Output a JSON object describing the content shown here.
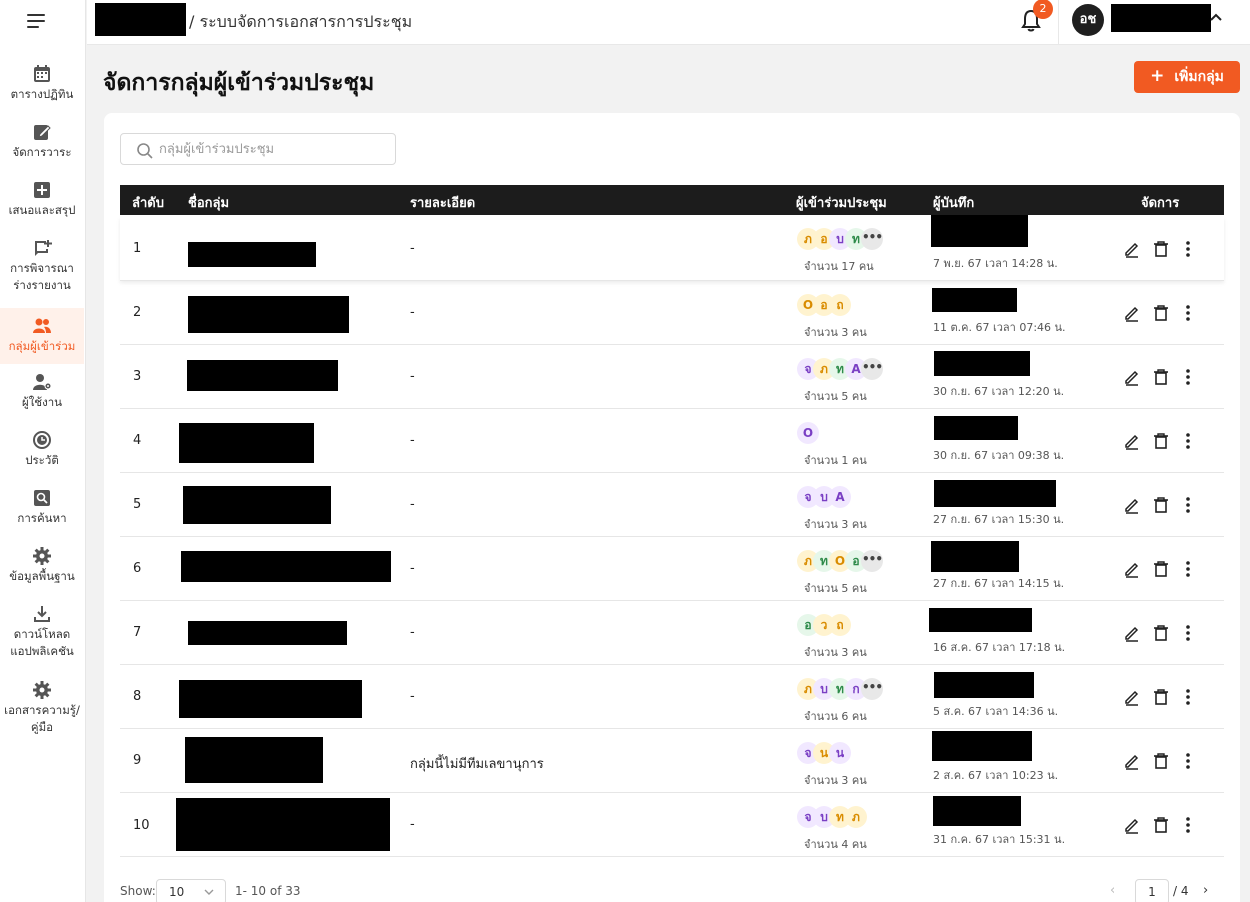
{
  "sidebar": {
    "items": [
      {
        "label": "ตารางปฏิทิน",
        "icon": "calendar-icon"
      },
      {
        "label": "จัดการวาระ",
        "icon": "edit-agenda-icon"
      },
      {
        "label": "เสนอและสรุป",
        "icon": "add-box-icon"
      },
      {
        "label": "การพิจารณาร่างรายงาน",
        "icon": "comment-add-icon"
      },
      {
        "label": "กลุ่มผู้เข้าร่วม",
        "icon": "group-icon",
        "active": true
      },
      {
        "label": "ผู้ใช้งาน",
        "icon": "user-settings-icon"
      },
      {
        "label": "ประวัติ",
        "icon": "history-icon"
      },
      {
        "label": "การค้นหา",
        "icon": "search-doc-icon"
      },
      {
        "label": "ข้อมูลพื้นฐาน",
        "icon": "gear-icon"
      },
      {
        "label": "ดาวน์โหลดแอปพลิเคชัน",
        "icon": "download-icon"
      },
      {
        "label": "เอกสารความรู้/คู่มือ",
        "icon": "gear-icon"
      }
    ]
  },
  "header": {
    "breadcrumb": "/ ระบบจัดการเอกสารการประชุม",
    "notification_count": "2",
    "avatar_initials": "อช"
  },
  "page": {
    "title": "จัดการกลุ่มผู้เข้าร่วมประชุม",
    "add_button": "เพิ่มกลุ่ม"
  },
  "search": {
    "placeholder": "กลุ่มผู้เข้าร่วมประชุม"
  },
  "table": {
    "columns": [
      "ลำดับ",
      "ชื่อกลุ่ม",
      "รายละเอียด",
      "ผู้เข้าร่วมประชุม",
      "ผู้บันทึก",
      "จัดการ"
    ],
    "rows": [
      {
        "no": "1",
        "detail": "-",
        "avatars": [
          "ภ",
          "อ",
          "บ",
          "ท"
        ],
        "more": true,
        "count": "จำนวน 17 คน",
        "date": "7 พ.ย. 67 เวลา 14:28 น."
      },
      {
        "no": "2",
        "detail": "-",
        "avatars": [
          "O",
          "อ",
          "ถ"
        ],
        "more": false,
        "count": "จำนวน 3 คน",
        "date": "11 ต.ค. 67 เวลา 07:46 น."
      },
      {
        "no": "3",
        "detail": "-",
        "avatars": [
          "จ",
          "ภ",
          "ท",
          "A"
        ],
        "more": true,
        "count": "จำนวน 5 คน",
        "date": "30 ก.ย. 67 เวลา 12:20 น."
      },
      {
        "no": "4",
        "detail": "-",
        "avatars": [
          "O"
        ],
        "more": false,
        "count": "จำนวน 1 คน",
        "date": "30 ก.ย. 67 เวลา 09:38 น."
      },
      {
        "no": "5",
        "detail": "-",
        "avatars": [
          "จ",
          "บ",
          "A"
        ],
        "more": false,
        "count": "จำนวน 3 คน",
        "date": "27 ก.ย. 67 เวลา 15:30 น."
      },
      {
        "no": "6",
        "detail": "-",
        "avatars": [
          "ภ",
          "ท",
          "O",
          "อ"
        ],
        "more": true,
        "count": "จำนวน 5 คน",
        "date": "27 ก.ย. 67 เวลา 14:15 น."
      },
      {
        "no": "7",
        "detail": "-",
        "avatars": [
          "อ",
          "ว",
          "ถ"
        ],
        "more": false,
        "count": "จำนวน 3 คน",
        "date": "16 ส.ค. 67 เวลา 17:18 น."
      },
      {
        "no": "8",
        "detail": "-",
        "avatars": [
          "ภ",
          "บ",
          "ท",
          "ก"
        ],
        "more": true,
        "count": "จำนวน 6 คน",
        "date": "5 ส.ค. 67 เวลา 14:36 น."
      },
      {
        "no": "9",
        "detail": "กลุ่มนี้ไม่มีทีมเลขานุการ",
        "avatars": [
          "จ",
          "น",
          "น"
        ],
        "more": false,
        "count": "จำนวน 3 คน",
        "date": "2 ส.ค. 67 เวลา 10:23 น."
      },
      {
        "no": "10",
        "detail": "-",
        "avatars": [
          "จ",
          "บ",
          "ท",
          "ภ"
        ],
        "more": false,
        "count": "จำนวน 4 คน",
        "date": "31 ก.ค. 67 เวลา 15:31 น."
      }
    ]
  },
  "footer": {
    "show_label": "Show:",
    "page_size": "10",
    "range": "1- 10 of 33",
    "current_page": "1",
    "total_pages": "/ 4"
  },
  "colors": {
    "accent": "#f15a22",
    "header_row": "#1c1c1c"
  }
}
